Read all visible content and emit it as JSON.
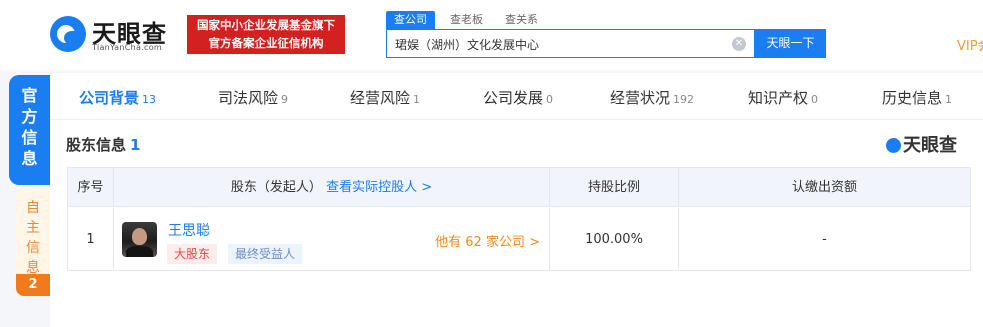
{
  "header": {
    "logo_text": "天眼查",
    "logo_sub": "TianYanCha.com",
    "banner_line1": "国家中小企业发展基金旗下",
    "banner_line2": "官方备案企业征信机构",
    "search_tabs": [
      "查公司",
      "查老板",
      "查关系"
    ],
    "search_value": "珺娱（湖州）文化发展中心",
    "search_button": "天眼一下",
    "vip_label": "VIP会"
  },
  "side_tabs": {
    "official": "官方信息",
    "own": "自主信息",
    "own_count": "2"
  },
  "nav": [
    {
      "label": "公司背景",
      "count": "13"
    },
    {
      "label": "司法风险",
      "count": "9"
    },
    {
      "label": "经营风险",
      "count": "1"
    },
    {
      "label": "公司发展",
      "count": "0"
    },
    {
      "label": "经营状况",
      "count": "192"
    },
    {
      "label": "知识产权",
      "count": "0"
    },
    {
      "label": "历史信息",
      "count": "1"
    }
  ],
  "section": {
    "title": "股东信息",
    "count": "1",
    "watermark": "天眼查"
  },
  "table": {
    "headers": {
      "index": "序号",
      "shareholder": "股东（发起人）",
      "shareholder_link": "查看实际控股人 >",
      "ratio": "持股比例",
      "capital": "认缴出资额"
    },
    "rows": [
      {
        "index": "1",
        "name": "王思聪",
        "tag1": "大股东",
        "tag2": "最终受益人",
        "holdings": "他有 62 家公司 >",
        "ratio": "100.00%",
        "capital": "-"
      }
    ]
  }
}
